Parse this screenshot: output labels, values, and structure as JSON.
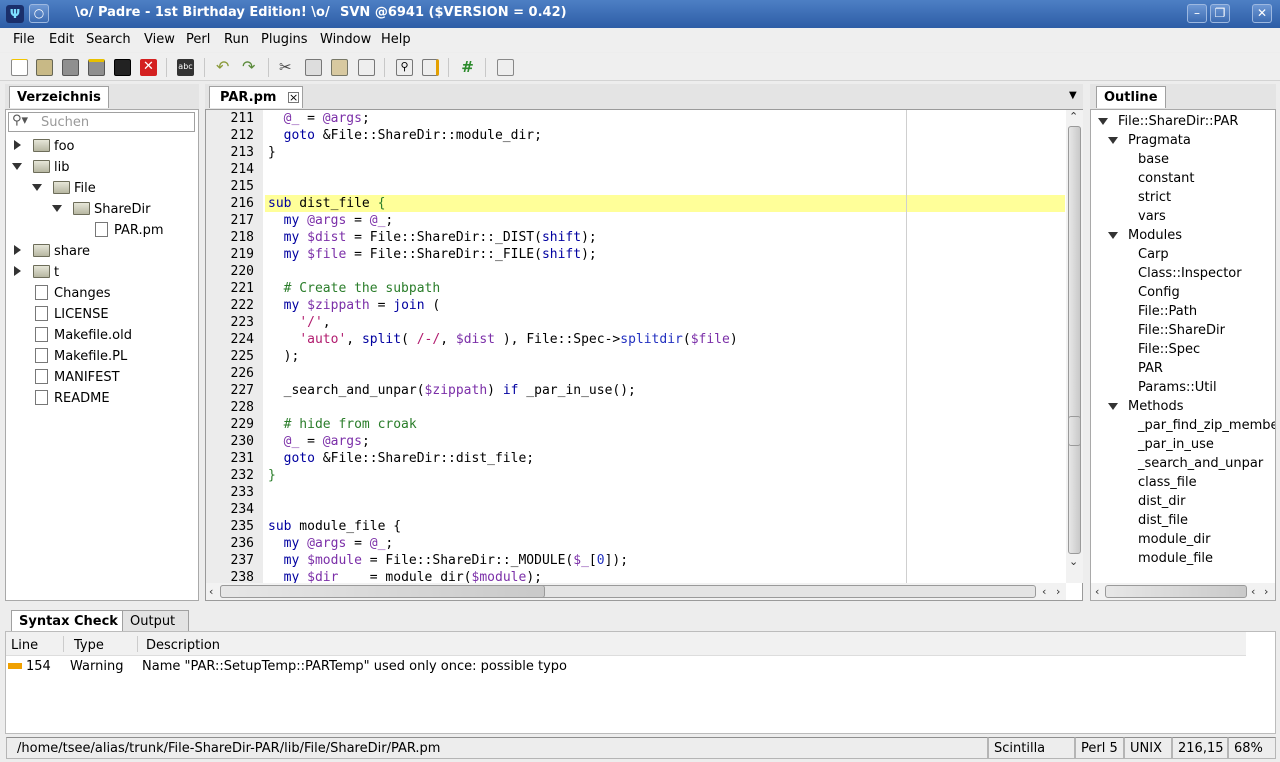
{
  "window": {
    "title": "\\o/ Padre - 1st Birthday Edition! \\o/",
    "svn": "SVN @6941 ($VERSION = 0.42)",
    "minimize": "–",
    "maximize": "❐",
    "close": "✕",
    "colors": {
      "titlebar": "#3d6cb2",
      "accent_line": "#ffff99"
    }
  },
  "menu": [
    "File",
    "Edit",
    "Search",
    "View",
    "Perl",
    "Run",
    "Plugins",
    "Window",
    "Help"
  ],
  "toolbar": {
    "icons": [
      "new-file-icon",
      "open-file-icon",
      "save-icon",
      "save-as-icon",
      "save-all-icon",
      "close-file-icon",
      "spellcheck-icon",
      "undo-icon",
      "redo-icon",
      "cut-icon",
      "copy-icon",
      "paste-icon",
      "select-all-icon",
      "find-icon",
      "replace-icon",
      "comment-toggle-icon",
      "goto-icon"
    ],
    "spellcheck_label": "abc",
    "comment_label": "#"
  },
  "left_panel": {
    "tab": "Verzeichnis",
    "search_placeholder": "Suchen",
    "tree": [
      {
        "label": "foo",
        "type": "folder",
        "depth": 0,
        "expanded": false
      },
      {
        "label": "lib",
        "type": "folder",
        "depth": 0,
        "expanded": true
      },
      {
        "label": "File",
        "type": "folder",
        "depth": 1,
        "expanded": true
      },
      {
        "label": "ShareDir",
        "type": "folder",
        "depth": 2,
        "expanded": true
      },
      {
        "label": "PAR.pm",
        "type": "file",
        "depth": 3
      },
      {
        "label": "share",
        "type": "folder",
        "depth": 0,
        "expanded": false
      },
      {
        "label": "t",
        "type": "folder",
        "depth": 0,
        "expanded": false
      },
      {
        "label": "Changes",
        "type": "file",
        "depth": 0
      },
      {
        "label": "LICENSE",
        "type": "file",
        "depth": 0
      },
      {
        "label": "Makefile.old",
        "type": "file",
        "depth": 0
      },
      {
        "label": "Makefile.PL",
        "type": "file",
        "depth": 0
      },
      {
        "label": "MANIFEST",
        "type": "file",
        "depth": 0
      },
      {
        "label": "README",
        "type": "file",
        "depth": 0
      }
    ]
  },
  "editor": {
    "tab": "PAR.pm",
    "tab_close": "×",
    "current_line": 216,
    "lines": [
      {
        "n": "211",
        "t": [
          [
            "  ",
            ""
          ],
          [
            "@_",
            "var"
          ],
          [
            " = ",
            ""
          ],
          [
            "@args",
            "var"
          ],
          [
            ";",
            ""
          ]
        ]
      },
      {
        "n": "212",
        "t": [
          [
            "  ",
            ""
          ],
          [
            "goto",
            "kw"
          ],
          [
            " &File::ShareDir::module_dir;",
            ""
          ]
        ]
      },
      {
        "n": "213",
        "t": [
          [
            "}",
            ""
          ]
        ]
      },
      {
        "n": "214",
        "t": []
      },
      {
        "n": "215",
        "t": []
      },
      {
        "n": "216",
        "t": [
          [
            "sub",
            "kw"
          ],
          [
            " dist_file ",
            ""
          ],
          [
            "{",
            "cm"
          ]
        ]
      },
      {
        "n": "217",
        "t": [
          [
            "  ",
            ""
          ],
          [
            "my",
            "kw"
          ],
          [
            " ",
            ""
          ],
          [
            "@args",
            "var"
          ],
          [
            " = ",
            ""
          ],
          [
            "@_",
            "var"
          ],
          [
            ";",
            ""
          ]
        ]
      },
      {
        "n": "218",
        "t": [
          [
            "  ",
            ""
          ],
          [
            "my",
            "kw"
          ],
          [
            " ",
            ""
          ],
          [
            "$dist",
            "var"
          ],
          [
            " = File::ShareDir::_DIST(",
            ""
          ],
          [
            "shift",
            "kw"
          ],
          [
            ");",
            ""
          ]
        ]
      },
      {
        "n": "219",
        "t": [
          [
            "  ",
            ""
          ],
          [
            "my",
            "kw"
          ],
          [
            " ",
            ""
          ],
          [
            "$file",
            "var"
          ],
          [
            " = File::ShareDir::_FILE(",
            ""
          ],
          [
            "shift",
            "kw"
          ],
          [
            ");",
            ""
          ]
        ]
      },
      {
        "n": "220",
        "t": []
      },
      {
        "n": "221",
        "t": [
          [
            "  ",
            ""
          ],
          [
            "# Create the subpath",
            "cm"
          ]
        ]
      },
      {
        "n": "222",
        "t": [
          [
            "  ",
            ""
          ],
          [
            "my",
            "kw"
          ],
          [
            " ",
            ""
          ],
          [
            "$zippath",
            "var"
          ],
          [
            " = ",
            ""
          ],
          [
            "join",
            "kw"
          ],
          [
            " (",
            ""
          ]
        ]
      },
      {
        "n": "223",
        "t": [
          [
            "    ",
            ""
          ],
          [
            "'/'",
            "str"
          ],
          [
            ",",
            ""
          ]
        ]
      },
      {
        "n": "224",
        "t": [
          [
            "    ",
            ""
          ],
          [
            "'auto'",
            "str"
          ],
          [
            ", ",
            ""
          ],
          [
            "split",
            "kw"
          ],
          [
            "( ",
            ""
          ],
          [
            "/-/",
            "str"
          ],
          [
            ", ",
            ""
          ],
          [
            "$dist",
            "var"
          ],
          [
            " ), File::Spec->",
            ""
          ],
          [
            "splitdir",
            "bl"
          ],
          [
            "(",
            ""
          ],
          [
            "$file",
            "var"
          ],
          [
            ")",
            ""
          ]
        ]
      },
      {
        "n": "225",
        "t": [
          [
            "  );",
            ""
          ]
        ]
      },
      {
        "n": "226",
        "t": []
      },
      {
        "n": "227",
        "t": [
          [
            "  _search_and_unpar(",
            ""
          ],
          [
            "$zippath",
            "var"
          ],
          [
            ") ",
            ""
          ],
          [
            "if",
            "kw"
          ],
          [
            " _par_in_use();",
            ""
          ]
        ]
      },
      {
        "n": "228",
        "t": []
      },
      {
        "n": "229",
        "t": [
          [
            "  ",
            ""
          ],
          [
            "# hide from croak",
            "cm"
          ]
        ]
      },
      {
        "n": "230",
        "t": [
          [
            "  ",
            ""
          ],
          [
            "@_",
            "var"
          ],
          [
            " = ",
            ""
          ],
          [
            "@args",
            "var"
          ],
          [
            ";",
            ""
          ]
        ]
      },
      {
        "n": "231",
        "t": [
          [
            "  ",
            ""
          ],
          [
            "goto",
            "kw"
          ],
          [
            " &File::ShareDir::dist_file;",
            ""
          ]
        ]
      },
      {
        "n": "232",
        "t": [
          [
            "}",
            "cm"
          ]
        ]
      },
      {
        "n": "233",
        "t": []
      },
      {
        "n": "234",
        "t": []
      },
      {
        "n": "235",
        "t": [
          [
            "sub",
            "kw"
          ],
          [
            " module_file {",
            ""
          ]
        ]
      },
      {
        "n": "236",
        "t": [
          [
            "  ",
            ""
          ],
          [
            "my",
            "kw"
          ],
          [
            " ",
            ""
          ],
          [
            "@args",
            "var"
          ],
          [
            " = ",
            ""
          ],
          [
            "@_",
            "var"
          ],
          [
            ";",
            ""
          ]
        ]
      },
      {
        "n": "237",
        "t": [
          [
            "  ",
            ""
          ],
          [
            "my",
            "kw"
          ],
          [
            " ",
            ""
          ],
          [
            "$module",
            "var"
          ],
          [
            " = File::ShareDir::_MODULE(",
            ""
          ],
          [
            "$_",
            "var"
          ],
          [
            "[",
            ""
          ],
          [
            "0",
            "bl"
          ],
          [
            "]);",
            ""
          ]
        ]
      },
      {
        "n": "238",
        "t": [
          [
            "  ",
            ""
          ],
          [
            "my",
            "kw"
          ],
          [
            " ",
            ""
          ],
          [
            "$dir",
            "var"
          ],
          [
            "    = module_dir(",
            ""
          ],
          [
            "$module",
            "var"
          ],
          [
            ");",
            ""
          ]
        ]
      }
    ]
  },
  "outline": {
    "tab": "Outline",
    "root": "File::ShareDir::PAR",
    "groups": [
      {
        "label": "Pragmata",
        "items": [
          "base",
          "constant",
          "strict",
          "vars"
        ]
      },
      {
        "label": "Modules",
        "items": [
          "Carp",
          "Class::Inspector",
          "Config",
          "File::Path",
          "File::ShareDir",
          "File::Spec",
          "PAR",
          "Params::Util"
        ]
      },
      {
        "label": "Methods",
        "items": [
          "_par_find_zip_member",
          "_par_in_use",
          "_search_and_unpar",
          "class_file",
          "dist_dir",
          "dist_file",
          "module_dir",
          "module_file"
        ]
      }
    ]
  },
  "bottom": {
    "tabs": [
      "Syntax Check",
      "Output"
    ],
    "columns": [
      "Line",
      "Type",
      "Description"
    ],
    "rows": [
      {
        "line": "154",
        "type": "Warning",
        "description": "Name \"PAR::SetupTemp::PARTemp\" used only once: possible typo",
        "marker_color": "#f0a000"
      }
    ]
  },
  "status": {
    "path": "/home/tsee/alias/trunk/File-ShareDir-PAR/lib/File/ShareDir/PAR.pm",
    "lexer": "Scintilla",
    "mime": "Perl 5",
    "newline": "UNIX",
    "position": "216,15",
    "percent": "68%"
  }
}
